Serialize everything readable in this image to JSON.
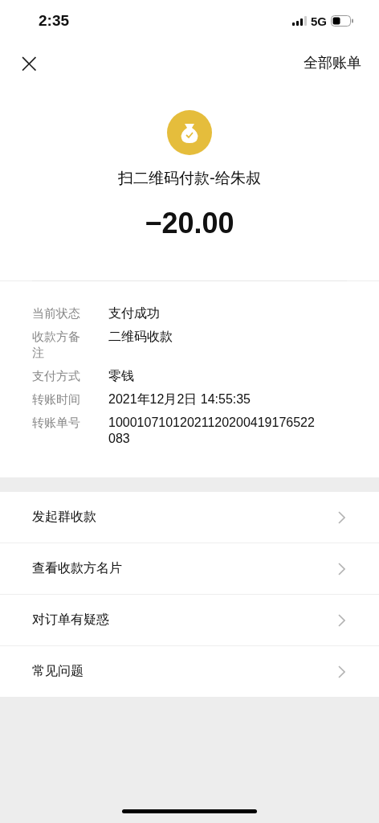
{
  "status_bar": {
    "time": "2:35",
    "network": "5G"
  },
  "nav": {
    "close": "×",
    "right_link": "全部账单"
  },
  "header": {
    "title": "扫二维码付款-给朱叔",
    "amount": "−20.00"
  },
  "details": [
    {
      "label": "当前状态",
      "value": "支付成功"
    },
    {
      "label": "收款方备注",
      "value": "二维码收款"
    },
    {
      "label": "支付方式",
      "value": "零钱"
    },
    {
      "label": "转账时间",
      "value": "2021年12月2日 14:55:35"
    },
    {
      "label": "转账单号",
      "value": "10001071012021120200419176522083"
    }
  ],
  "menu": [
    {
      "label": "发起群收款"
    },
    {
      "label": "查看收款方名片"
    },
    {
      "label": "对订单有疑惑"
    },
    {
      "label": "常见问题"
    }
  ]
}
